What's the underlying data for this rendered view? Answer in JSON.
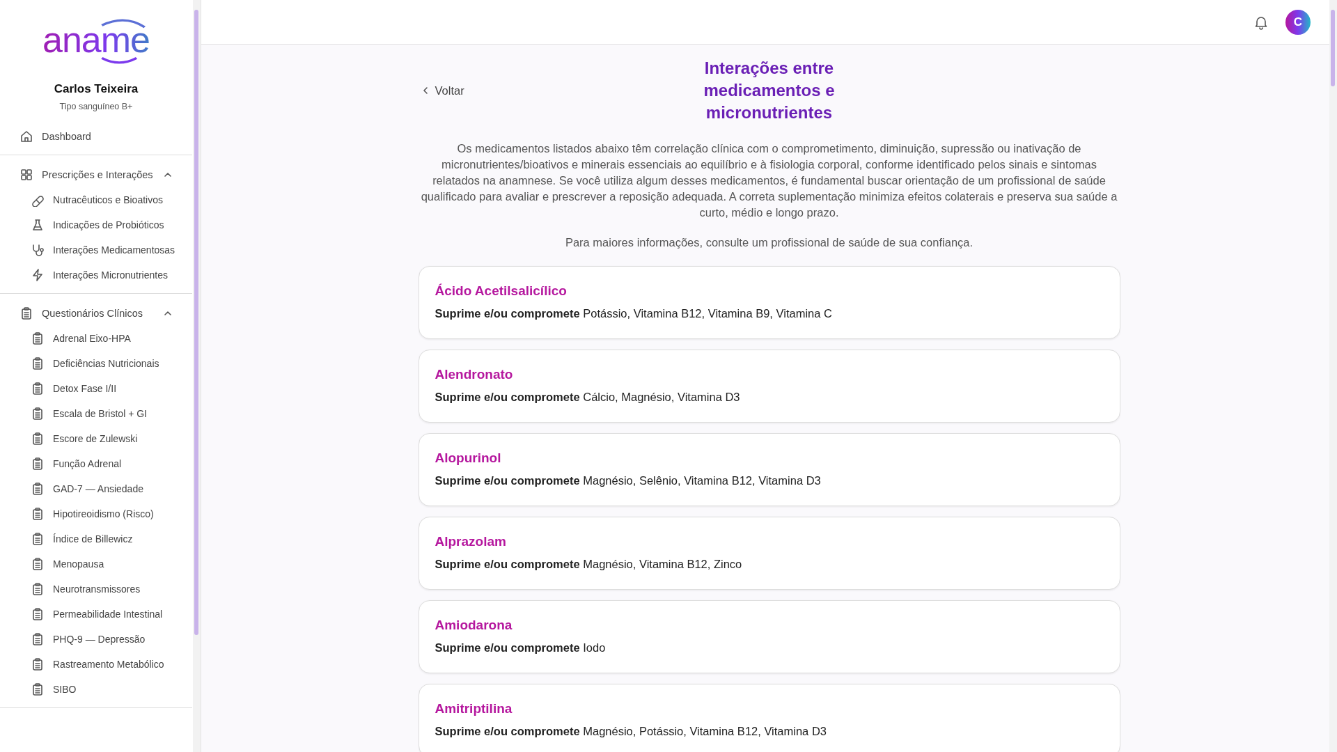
{
  "logo_text": "aname",
  "user": {
    "name": "Carlos Teixeira",
    "subtitle": "Tipo sanguíneo B+"
  },
  "sidebar": {
    "top_items": [
      {
        "label": "Dashboard",
        "selected": false
      }
    ],
    "groups": [
      {
        "label": "Prescrições e Interações",
        "expanded": true,
        "children": [
          {
            "label": "Nutracêuticos e Bioativos",
            "selected": false
          },
          {
            "label": "Indicações de Probióticos",
            "selected": false
          },
          {
            "label": "Interações Medicamentosas",
            "selected": false
          },
          {
            "label": "Interações Micronutrientes",
            "selected": false
          }
        ]
      },
      {
        "label": "Questionários Clínicos",
        "expanded": true,
        "children": [
          {
            "label": "Adrenal Eixo-HPA",
            "selected": false
          },
          {
            "label": "Deficiências Nutricionais",
            "selected": false
          },
          {
            "label": "Detox Fase I/II",
            "selected": false
          },
          {
            "label": "Escala de Bristol + GI",
            "selected": false
          },
          {
            "label": "Escore de Zulewski",
            "selected": false
          },
          {
            "label": "Função Adrenal",
            "selected": false
          },
          {
            "label": "GAD-7 — Ansiedade",
            "selected": false
          },
          {
            "label": "Hipotireoidismo (Risco)",
            "selected": false
          },
          {
            "label": "Índice de Billewicz",
            "selected": false
          },
          {
            "label": "Menopausa",
            "selected": false
          },
          {
            "label": "Neurotransmissores",
            "selected": false
          },
          {
            "label": "Permeabilidade Intestinal",
            "selected": false
          },
          {
            "label": "PHQ-9 — Depressão",
            "selected": false
          },
          {
            "label": "Rastreamento Metabólico",
            "selected": false
          },
          {
            "label": "SIBO",
            "selected": false
          }
        ]
      }
    ]
  },
  "header": {
    "avatar_initial": "C"
  },
  "back_link": "Voltar",
  "title": "Interações entre medicamentos e micronutrientes",
  "intro": "Os medicamentos listados abaixo têm correlação clínica com o comprometimento, diminuição, supressão ou inativação de micronutrientes/bioativos e minerais essenciais ao equilíbrio e à fisiologia corporal, conforme identificado pelos sinais e sintomas relatados na anamnese. Se você utiliza algum desses medicamentos, é fundamental buscar orientação de um profissional de saúde qualificado para avaliar e prescrever a reposição adequada. A correta suplementação minimiza efeitos colaterais e preserva sua saúde a curto, médio e longo prazo.",
  "note": "Para maiores informações, consulte um profissional de saúde de sua confiança.",
  "medications": [
    {
      "name": "Ácido Acetilsalicílico",
      "effect": "**Suprime e/ou compromete** Potássio, Vitamina B12, Vitamina B9, Vitamina C"
    },
    {
      "name": "Alendronato",
      "effect": "**Suprime e/ou compromete** Cálcio, Magnésio, Vitamina D3"
    },
    {
      "name": "Alopurinol",
      "effect": "**Suprime e/ou compromete** Magnésio, Selênio, Vitamina B12, Vitamina D3"
    },
    {
      "name": "Alprazolam",
      "effect": "**Suprime e/ou compromete** Magnésio, Vitamina B12, Zinco"
    },
    {
      "name": "Amiodarona",
      "effect": "**Suprime e/ou compromete** Iodo"
    },
    {
      "name": "Amitriptilina",
      "effect": "**Suprime e/ou compromete** Magnésio, Potássio, Vitamina B12, Vitamina D3"
    }
  ]
}
